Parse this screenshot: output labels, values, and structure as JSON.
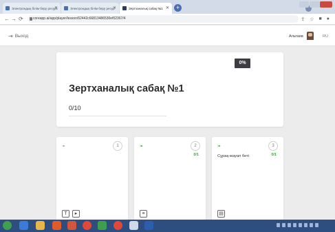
{
  "browser": {
    "tabs": [
      {
        "label": "Электрондық білім беру ресурс",
        "active": false
      },
      {
        "label": "Электрондық білім беру ресур",
        "active": false
      },
      {
        "label": "Зертханалық сабақ №1",
        "active": true
      }
    ],
    "new_tab_label": "+",
    "url": "coreapp.ai/app/player/lesson/62442c66813486530ef02367/4",
    "icons": [
      "back-icon",
      "forward-icon",
      "reload-icon",
      "lock-icon",
      "share-icon",
      "star-icon",
      "extensions-icon",
      "profile-icon"
    ]
  },
  "header": {
    "logout_label": "Выход",
    "logout_icon": "logout-icon",
    "user_name": "Альтаев",
    "language": "RU"
  },
  "lesson": {
    "subtitle": "",
    "percent": "0%",
    "percent_label": "",
    "title": "Зертханалық сабақ №1",
    "progress_count": "0/10",
    "progress_label": ""
  },
  "tasks": [
    {
      "status": "",
      "status_ok": false,
      "number": "1",
      "score": "",
      "name": "",
      "types": [
        "text-icon",
        "video-icon"
      ]
    },
    {
      "status": "",
      "status_ok": true,
      "number": "2",
      "score": "0/1",
      "name": "",
      "types": [
        "quiz-icon"
      ]
    },
    {
      "status": "",
      "status_ok": true,
      "number": "3",
      "score": "0/1",
      "name": "Сұрақ-жауап беті",
      "types": [
        "page-icon"
      ]
    }
  ],
  "colors": {
    "accent_green": "#3aa33a",
    "badge_dark": "#3b3d42",
    "taskbar": "#2d4e7e",
    "page_bg": "#ececec"
  }
}
